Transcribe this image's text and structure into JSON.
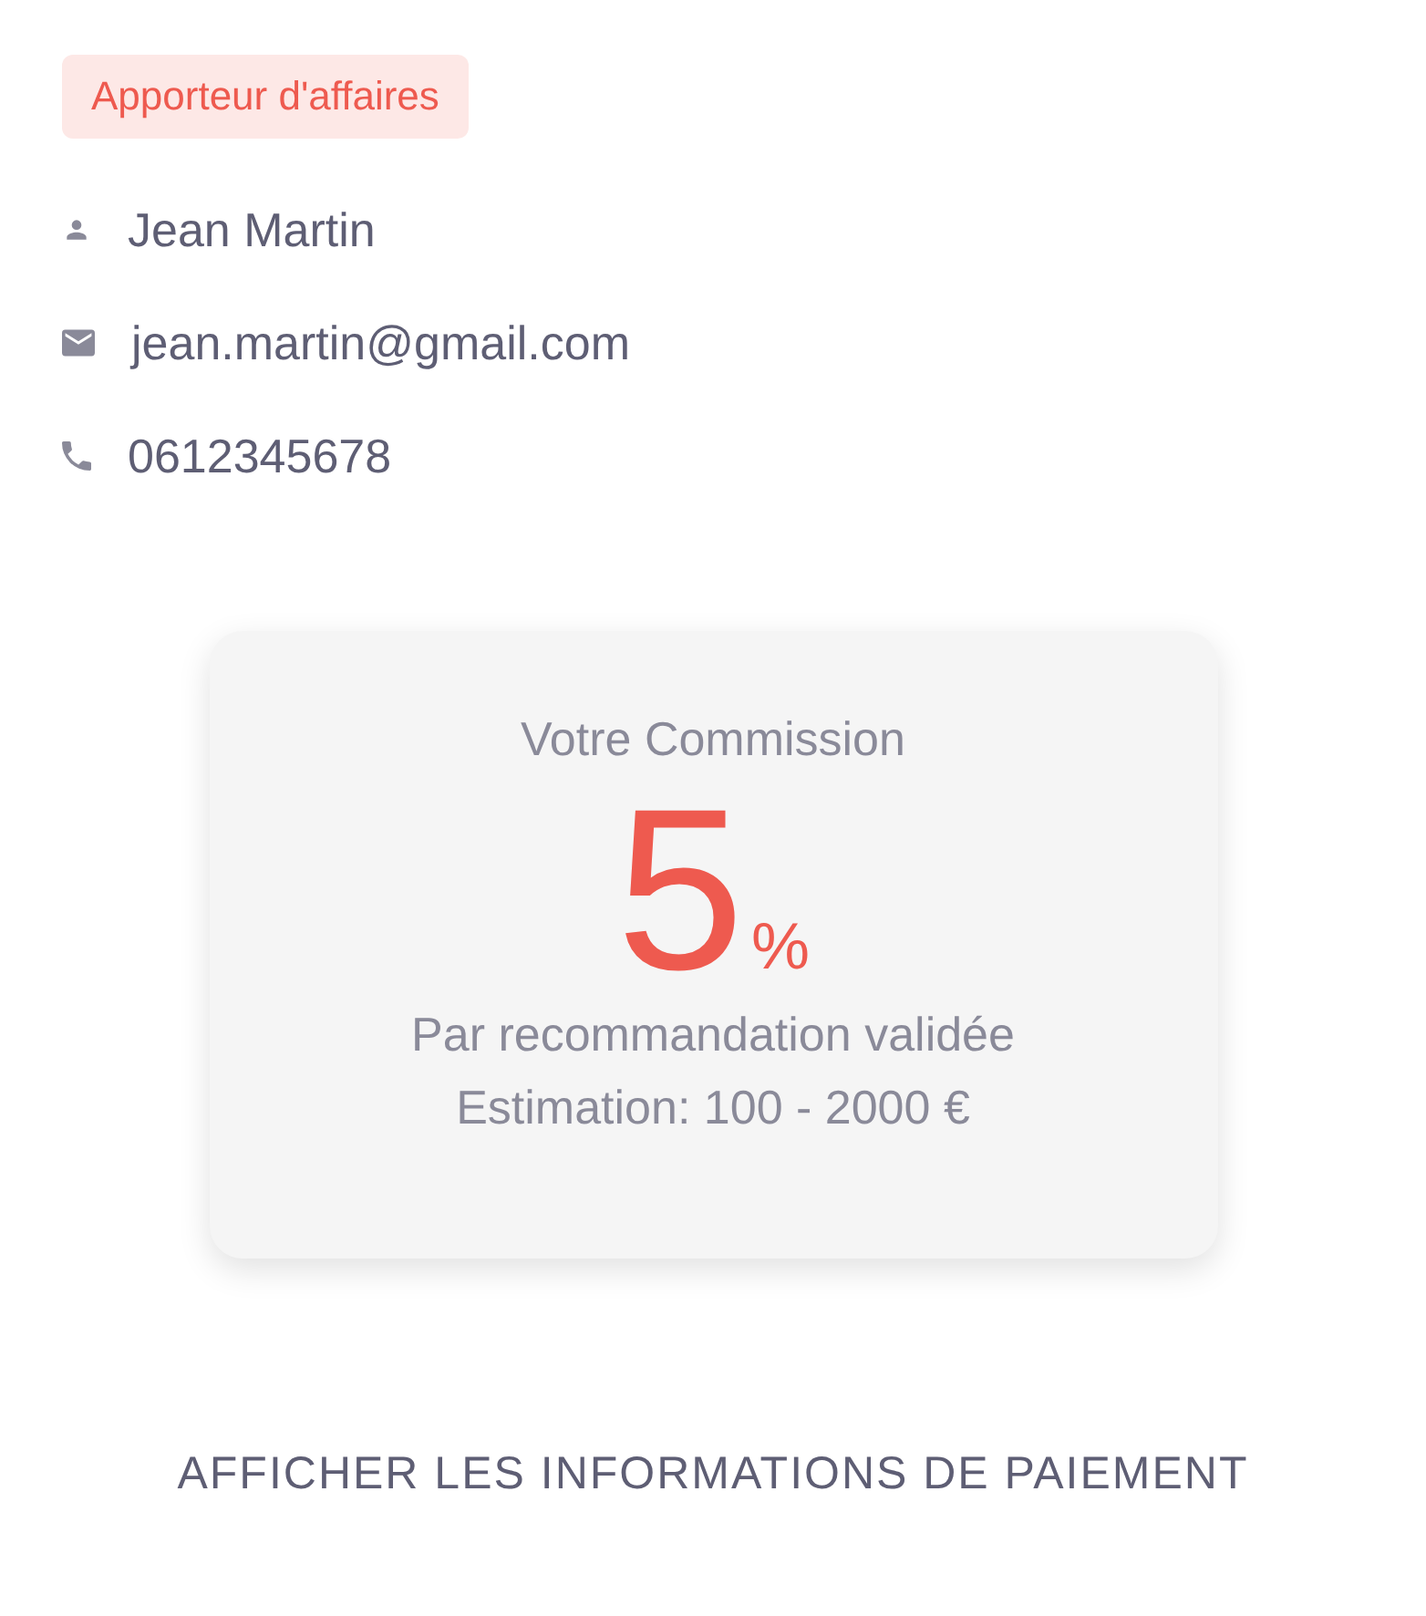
{
  "badge": "Apporteur d'affaires",
  "contacts": [
    {
      "kind": "person",
      "text": "Jean Martin"
    },
    {
      "kind": "email",
      "text": "jean.martin@gmail.com"
    },
    {
      "kind": "phone",
      "text": "0612345678"
    }
  ],
  "commission": {
    "title": "Votre Commission",
    "value": "5",
    "unit": "%",
    "lines": [
      "Par recommandation validée",
      "Estimation: 100 - 2000 €"
    ]
  },
  "action": "AFFICHER LES INFORMATIONS DE PAIEMENT"
}
